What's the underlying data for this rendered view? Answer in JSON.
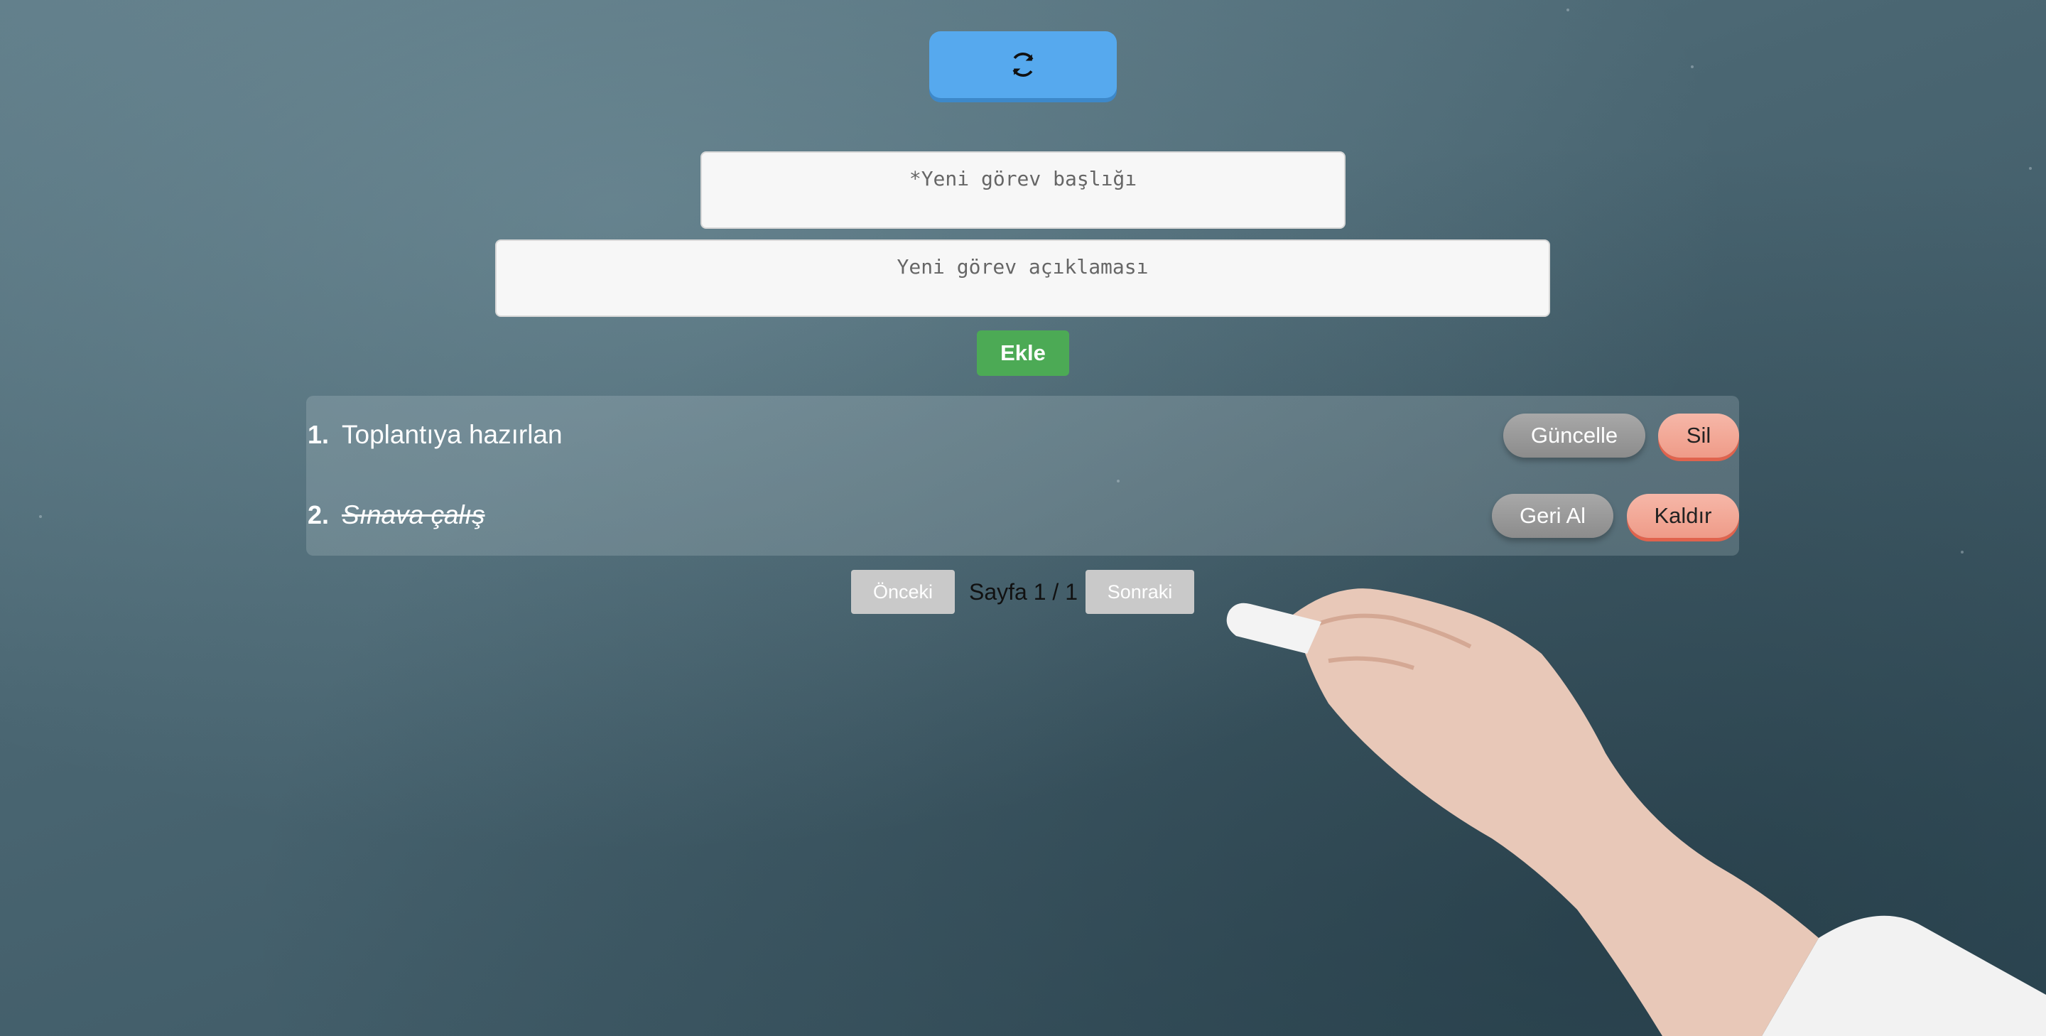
{
  "refresh": {
    "icon": "refresh-icon"
  },
  "form": {
    "title_placeholder": "*Yeni görev başlığı",
    "description_placeholder": "Yeni görev açıklaması",
    "add_label": "Ekle"
  },
  "tasks": [
    {
      "number": "1.",
      "text": "Toplantıya hazırlan",
      "done": false,
      "action_label": "Güncelle",
      "delete_label": "Sil"
    },
    {
      "number": "2.",
      "text": "Sınava çalış",
      "done": true,
      "action_label": "Geri Al",
      "delete_label": "Kaldır"
    }
  ],
  "pagination": {
    "prev_label": "Önceki",
    "page_label": "Sayfa 1 / 1",
    "next_label": "Sonraki"
  },
  "colors": {
    "refresh_button": "#56a9ee",
    "add_button": "#4caa55",
    "delete_button": "#f6b7a8",
    "secondary_button": "#999999"
  }
}
